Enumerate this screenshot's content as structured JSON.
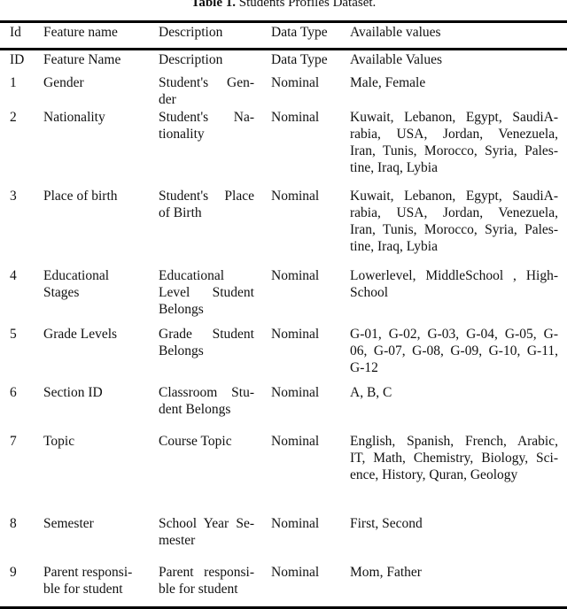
{
  "caption": {
    "label": "Table 1.",
    "text": " Students Profiles Dataset."
  },
  "header": {
    "id": "Id",
    "name": "Feature name",
    "desc": "Description",
    "type": "Data Type",
    "vals": "Available values"
  },
  "rows": [
    {
      "id": "ID",
      "name": "Feature Name",
      "desc": "Description",
      "type": "Data Type",
      "vals": "Available Values"
    },
    {
      "id": "1",
      "name": "Gender",
      "desc": "Student's Gen-\nder",
      "type": "Nominal",
      "vals": "Male, Female"
    },
    {
      "id": "2",
      "name": "Nationality",
      "desc": "Student's Na-\ntionality",
      "type": "Nominal",
      "vals": "Kuwait, Lebanon, Egypt, SaudiA-\nrabia, USA, Jordan, Venezuela,\nIran, Tunis, Morocco, Syria, Pales-\ntine, Iraq, Lybia"
    },
    {
      "id": "3",
      "name": "Place of birth",
      "desc": "Student's Place\nof Birth",
      "type": "Nominal",
      "vals": "Kuwait, Lebanon, Egypt, SaudiA-\nrabia, USA, Jordan, Venezuela,\nIran, Tunis, Morocco, Syria, Pales-\ntine, Iraq, Lybia"
    },
    {
      "id": "4",
      "name": "Educational\nStages",
      "desc": "Educational\nLevel Student\nBelongs",
      "type": "Nominal",
      "vals": "Lowerlevel, MiddleSchool , High-\nSchool"
    },
    {
      "id": "5",
      "name": "Grade Levels",
      "desc": "Grade Student\nBelongs",
      "type": "Nominal",
      "vals": "G-01, G-02, G-03, G-04, G-05, G-\n06, G-07, G-08, G-09, G-10, G-11,\nG-12"
    },
    {
      "id": "6",
      "name": "Section ID",
      "desc": "Classroom Stu-\ndent Belongs",
      "type": "Nominal",
      "vals": "A, B, C"
    },
    {
      "id": "7",
      "name": "Topic",
      "desc": "Course Topic",
      "type": "Nominal",
      "vals": "English, Spanish, French, Arabic,\nIT, Math, Chemistry, Biology, Sci-\nence, History, Quran, Geology"
    },
    {
      "id": "8",
      "name": "Semester",
      "desc": "School Year Se-\nmester",
      "type": "Nominal",
      "vals": "First, Second"
    },
    {
      "id": "9",
      "name": "Parent responsi-\nble for student",
      "desc": "Parent responsi-\nble for student",
      "type": "Nominal",
      "vals": "Mom, Father"
    }
  ]
}
